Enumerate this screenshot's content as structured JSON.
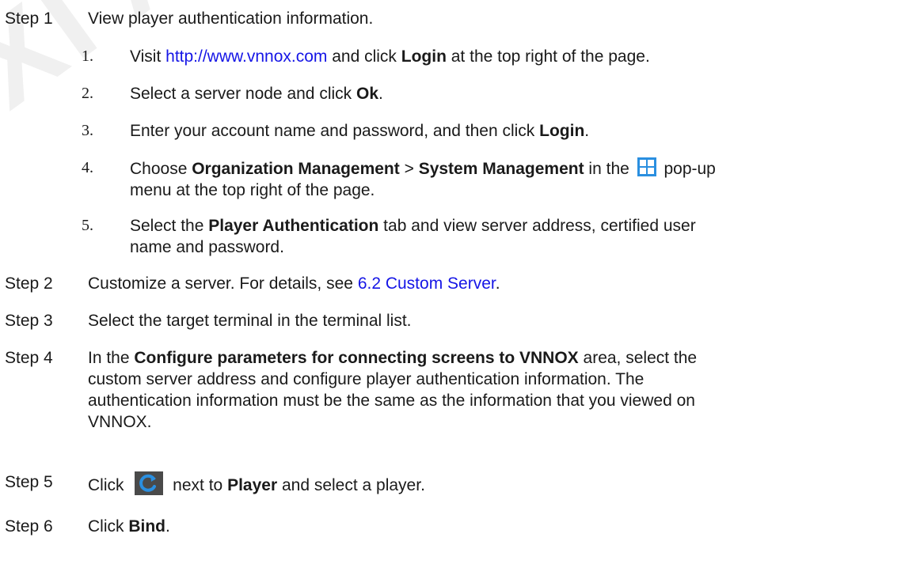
{
  "watermark": "XI'AN NOVA",
  "steps": [
    {
      "label": "Step 1",
      "text": "View player authentication information."
    },
    {
      "label": "Step 2",
      "before": "Customize a server. For details, see ",
      "link": "6.2 Custom Server",
      "after": "."
    },
    {
      "label": "Step 3",
      "text": "Select the target terminal in the terminal list."
    },
    {
      "label": "Step 4",
      "before": "In the ",
      "bold": "Configure parameters for connecting screens to VNNOX",
      "after_line1": " area, select the",
      "line2": "custom server address and configure player authentication information. The",
      "line3": "authentication information must be the same as the information that you viewed on",
      "line4": "VNNOX."
    },
    {
      "label": "Step 5",
      "before": "Click ",
      "middle": " next to ",
      "bold": "Player",
      "after": " and select a player.",
      "icon": "refresh-icon"
    },
    {
      "label": "Step 6",
      "before": "Click ",
      "bold": "Bind",
      "after": "."
    }
  ],
  "substeps": [
    {
      "num": "1.",
      "before": "Visit ",
      "link": "http://www.vnnox.com",
      "middle": " and click ",
      "bold": "Login",
      "after": " at the top right of the page."
    },
    {
      "num": "2.",
      "before": "Select a server node and click ",
      "bold": "Ok",
      "after": "."
    },
    {
      "num": "3.",
      "before": "Enter your account name and password, and then click ",
      "bold": "Login",
      "after": "."
    },
    {
      "num": "4.",
      "before": "Choose ",
      "bold1": "Organization Management",
      "sep": " > ",
      "bold2": "System Management",
      "middle": " in the ",
      "after": " pop-up",
      "line2": "menu at the top right of the page.",
      "icon": "grid-menu-icon"
    },
    {
      "num": "5.",
      "before": "Select the ",
      "bold": "Player Authentication",
      "after": " tab and view server address, certified user",
      "line2": "name and password."
    }
  ],
  "colors": {
    "link": "#1515e6",
    "grid_icon": "#2a8fe0",
    "refresh_icon_bg": "#4a4a4a",
    "refresh_icon_arrow": "#2a8fe0"
  }
}
